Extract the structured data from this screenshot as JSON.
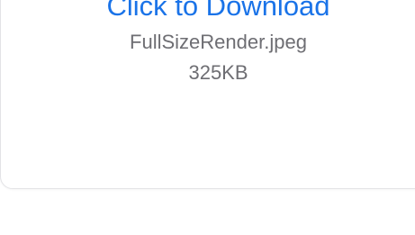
{
  "attachment": {
    "download_label": "Click to Download",
    "file_name": "FullSizeRender.jpeg",
    "file_size": "325KB"
  },
  "colors": {
    "link": "#1a73e8",
    "meta_text": "#6e6e73",
    "card_border": "#e3e3e6"
  }
}
